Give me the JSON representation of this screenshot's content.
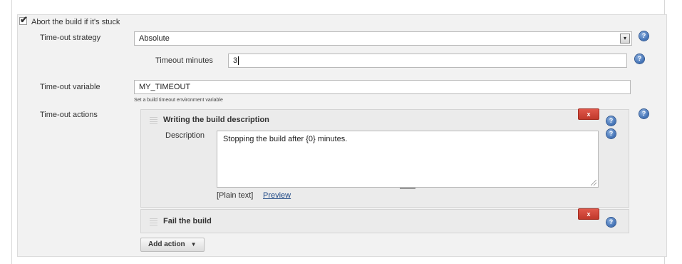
{
  "section": {
    "checkbox_label": "Abort the build if it's stuck",
    "checked": true
  },
  "strategy": {
    "label": "Time-out strategy",
    "selected": "Absolute"
  },
  "timeout_minutes": {
    "label": "Timeout minutes",
    "value": "3"
  },
  "variable": {
    "label": "Time-out variable",
    "value": "MY_TIMEOUT",
    "hint": "Set a build timeout environment variable"
  },
  "actions": {
    "label": "Time-out actions",
    "items": [
      {
        "title": "Writing the build description",
        "delete_label": "x",
        "description_label": "Description",
        "description_value": "Stopping the build after {0} minutes.",
        "plain_text": "[Plain text]",
        "preview": "Preview"
      },
      {
        "title": "Fail the build",
        "delete_label": "x"
      }
    ],
    "add_button": "Add action",
    "add_caret": "▼"
  },
  "help_glyph": "?",
  "icons": [
    "checkbox-icon",
    "help-icon",
    "dropdown-arrow-icon",
    "delete-icon",
    "drag-handle-icon",
    "resize-handle-icon"
  ]
}
